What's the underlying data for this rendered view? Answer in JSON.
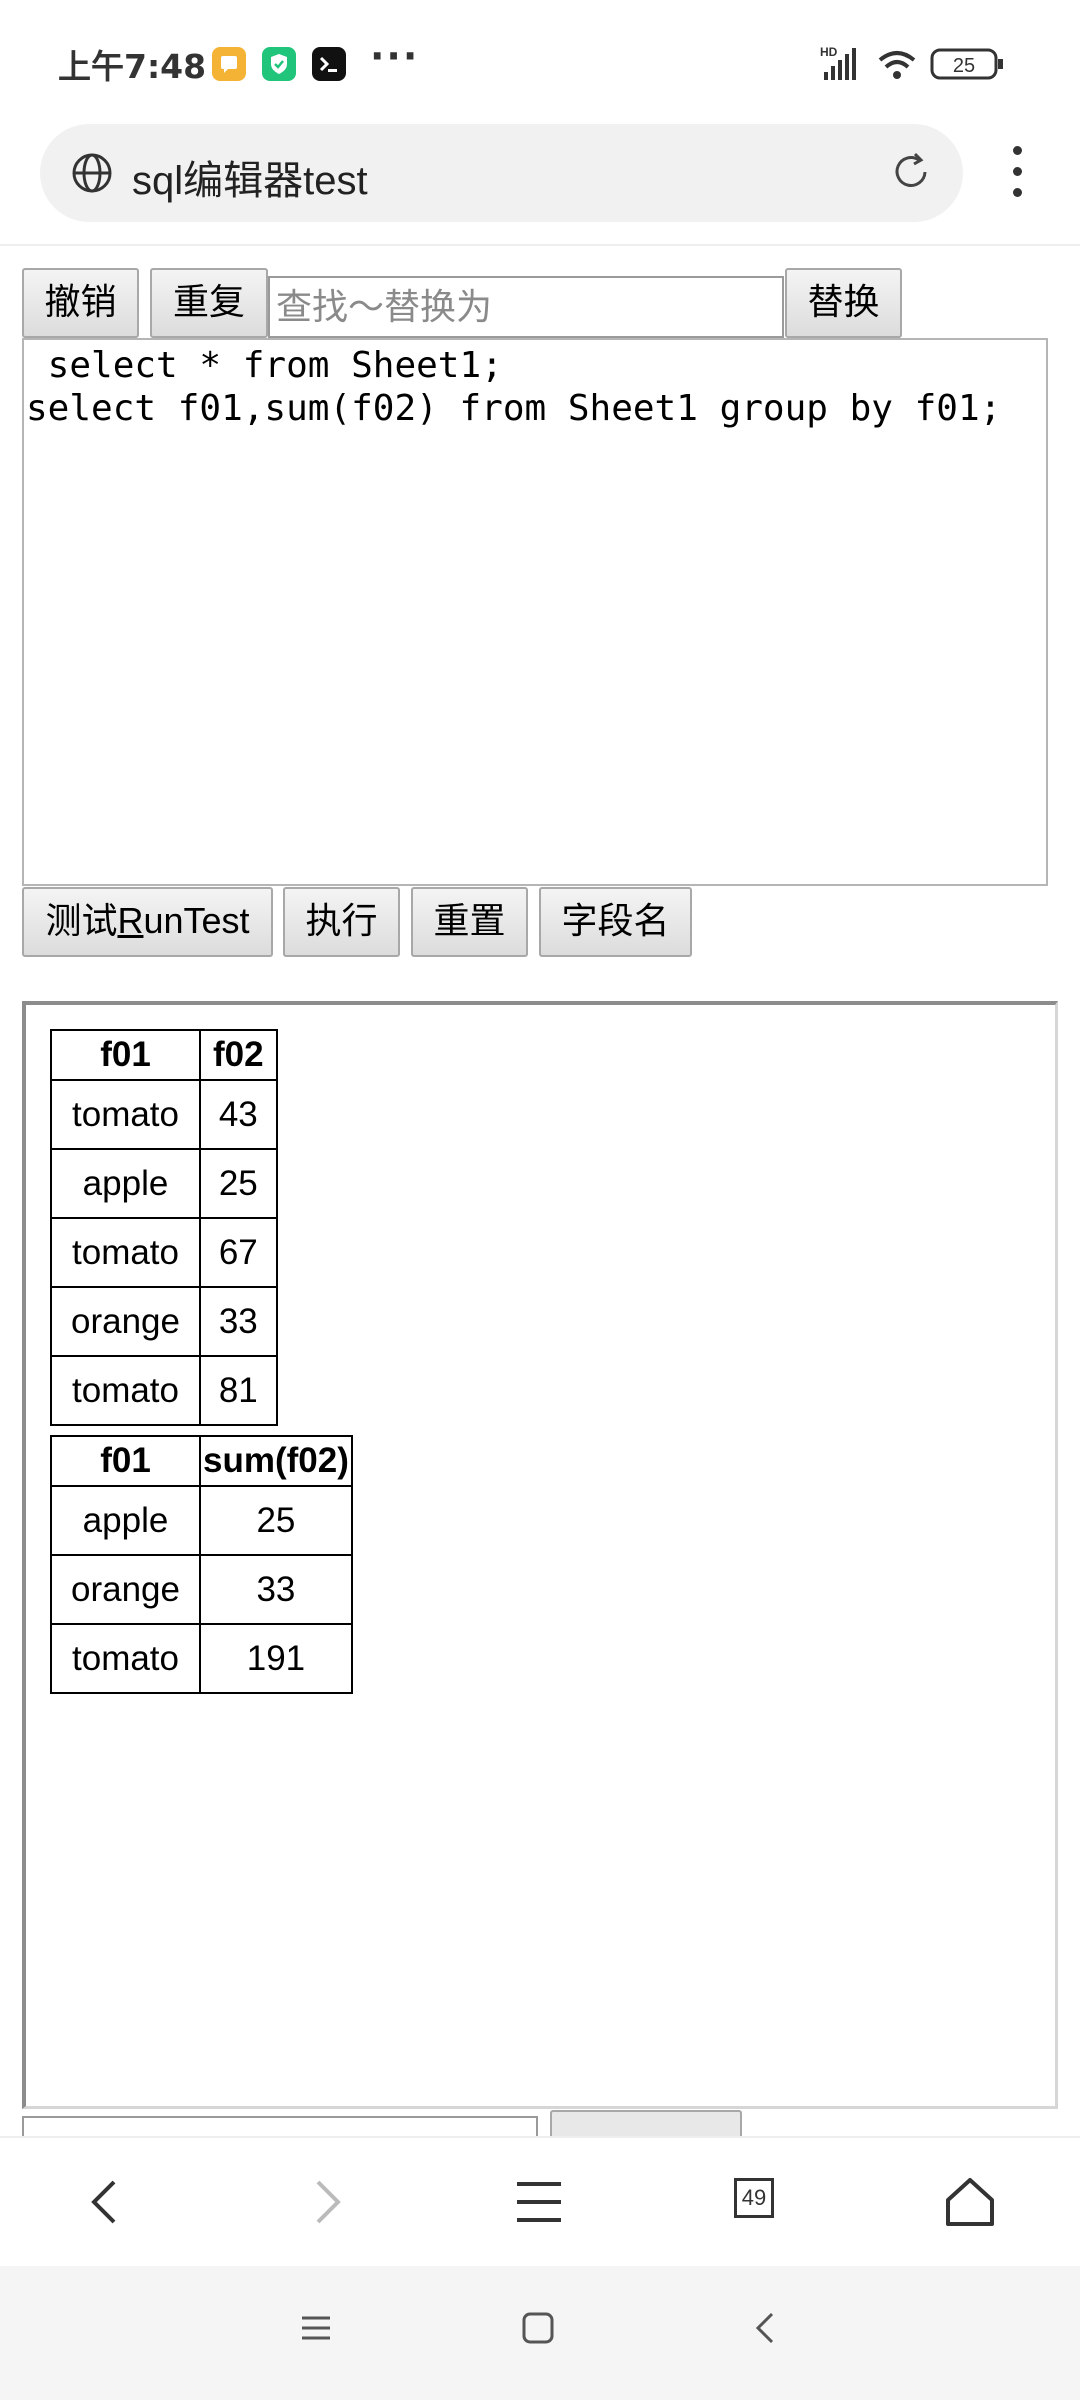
{
  "status_bar": {
    "time": "上午7:48",
    "battery": "25",
    "network_label": "HD"
  },
  "browser": {
    "page_title": "sql编辑器test",
    "tab_count": "49"
  },
  "toolbar": {
    "undo_label": "撤销",
    "redo_label": "重复",
    "find_placeholder": "查找～替换为",
    "replace_label": "替换"
  },
  "editor": {
    "content": " select * from Sheet1;\nselect f01,sum(f02) from Sheet1 group by f01;"
  },
  "actions": {
    "run_test_prefix": "测试",
    "run_test_underlined": "R",
    "run_test_suffix": "unTest",
    "execute_label": "执行",
    "reset_label": "重置",
    "field_names_label": "字段名"
  },
  "results": {
    "table1": {
      "headers": [
        "f01",
        "f02"
      ],
      "rows": [
        [
          "tomato",
          "43"
        ],
        [
          "apple",
          "25"
        ],
        [
          "tomato",
          "67"
        ],
        [
          "orange",
          "33"
        ],
        [
          "tomato",
          "81"
        ]
      ]
    },
    "table2": {
      "headers": [
        "f01",
        "sum(f02)"
      ],
      "rows": [
        [
          "apple",
          "25"
        ],
        [
          "orange",
          "33"
        ],
        [
          "tomato",
          "191"
        ]
      ]
    }
  }
}
